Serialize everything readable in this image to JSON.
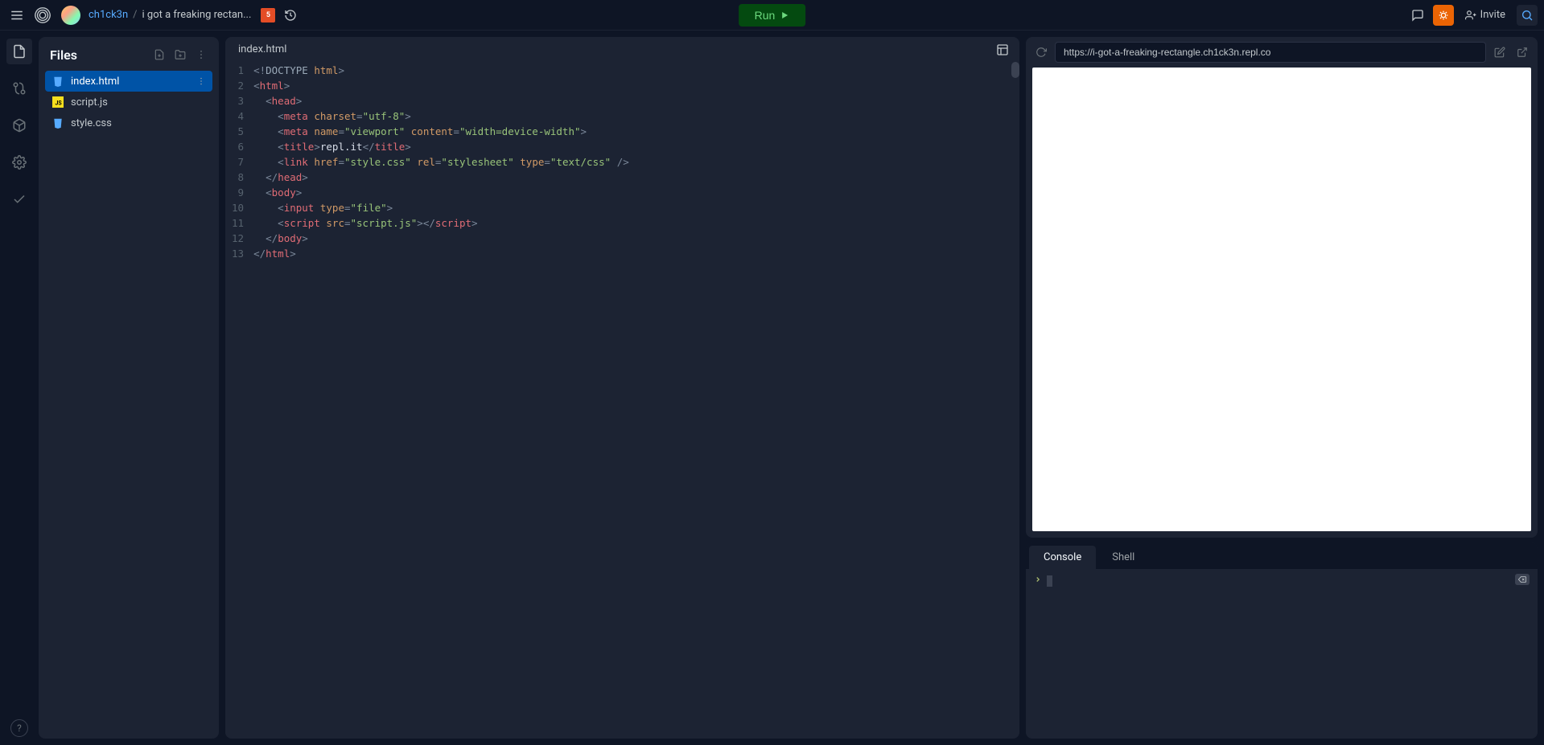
{
  "header": {
    "username": "ch1ck3n",
    "project": "i got a freaking rectan...",
    "run_label": "Run",
    "invite_label": "Invite",
    "lang_badge": "5"
  },
  "files": {
    "title": "Files",
    "items": [
      {
        "name": "index.html",
        "active": true,
        "icon": "html"
      },
      {
        "name": "script.js",
        "active": false,
        "icon": "js"
      },
      {
        "name": "style.css",
        "active": false,
        "icon": "css"
      }
    ]
  },
  "editor": {
    "tab": "index.html",
    "lines": 13,
    "code": [
      {
        "tokens": [
          {
            "c": "bracket",
            "t": "<!"
          },
          {
            "c": "doctype",
            "t": "DOCTYPE"
          },
          {
            "c": "text",
            "t": " "
          },
          {
            "c": "attr",
            "t": "html"
          },
          {
            "c": "bracket",
            "t": ">"
          }
        ]
      },
      {
        "tokens": [
          {
            "c": "bracket",
            "t": "<"
          },
          {
            "c": "tag",
            "t": "html"
          },
          {
            "c": "bracket",
            "t": ">"
          }
        ]
      },
      {
        "tokens": [
          {
            "c": "text",
            "t": "  "
          },
          {
            "c": "bracket",
            "t": "<"
          },
          {
            "c": "tag",
            "t": "head"
          },
          {
            "c": "bracket",
            "t": ">"
          }
        ]
      },
      {
        "tokens": [
          {
            "c": "text",
            "t": "    "
          },
          {
            "c": "bracket",
            "t": "<"
          },
          {
            "c": "tag",
            "t": "meta"
          },
          {
            "c": "text",
            "t": " "
          },
          {
            "c": "attr",
            "t": "charset"
          },
          {
            "c": "bracket",
            "t": "="
          },
          {
            "c": "str",
            "t": "\"utf-8\""
          },
          {
            "c": "bracket",
            "t": ">"
          }
        ]
      },
      {
        "tokens": [
          {
            "c": "text",
            "t": "    "
          },
          {
            "c": "bracket",
            "t": "<"
          },
          {
            "c": "tag",
            "t": "meta"
          },
          {
            "c": "text",
            "t": " "
          },
          {
            "c": "attr",
            "t": "name"
          },
          {
            "c": "bracket",
            "t": "="
          },
          {
            "c": "str",
            "t": "\"viewport\""
          },
          {
            "c": "text",
            "t": " "
          },
          {
            "c": "attr",
            "t": "content"
          },
          {
            "c": "bracket",
            "t": "="
          },
          {
            "c": "str",
            "t": "\"width=device-width\""
          },
          {
            "c": "bracket",
            "t": ">"
          }
        ]
      },
      {
        "tokens": [
          {
            "c": "text",
            "t": "    "
          },
          {
            "c": "bracket",
            "t": "<"
          },
          {
            "c": "tag",
            "t": "title"
          },
          {
            "c": "bracket",
            "t": ">"
          },
          {
            "c": "text",
            "t": "repl.it"
          },
          {
            "c": "bracket",
            "t": "</"
          },
          {
            "c": "tag",
            "t": "title"
          },
          {
            "c": "bracket",
            "t": ">"
          }
        ]
      },
      {
        "tokens": [
          {
            "c": "text",
            "t": "    "
          },
          {
            "c": "bracket",
            "t": "<"
          },
          {
            "c": "tag",
            "t": "link"
          },
          {
            "c": "text",
            "t": " "
          },
          {
            "c": "attr",
            "t": "href"
          },
          {
            "c": "bracket",
            "t": "="
          },
          {
            "c": "str",
            "t": "\"style.css\""
          },
          {
            "c": "text",
            "t": " "
          },
          {
            "c": "attr",
            "t": "rel"
          },
          {
            "c": "bracket",
            "t": "="
          },
          {
            "c": "str",
            "t": "\"stylesheet\""
          },
          {
            "c": "text",
            "t": " "
          },
          {
            "c": "attr",
            "t": "type"
          },
          {
            "c": "bracket",
            "t": "="
          },
          {
            "c": "str",
            "t": "\"text/css\""
          },
          {
            "c": "text",
            "t": " "
          },
          {
            "c": "bracket",
            "t": "/>"
          }
        ]
      },
      {
        "tokens": [
          {
            "c": "text",
            "t": "  "
          },
          {
            "c": "bracket",
            "t": "</"
          },
          {
            "c": "tag",
            "t": "head"
          },
          {
            "c": "bracket",
            "t": ">"
          }
        ]
      },
      {
        "tokens": [
          {
            "c": "text",
            "t": "  "
          },
          {
            "c": "bracket",
            "t": "<"
          },
          {
            "c": "tag",
            "t": "body"
          },
          {
            "c": "bracket",
            "t": ">"
          }
        ]
      },
      {
        "tokens": [
          {
            "c": "text",
            "t": "    "
          },
          {
            "c": "bracket",
            "t": "<"
          },
          {
            "c": "tag",
            "t": "input"
          },
          {
            "c": "text",
            "t": " "
          },
          {
            "c": "attr",
            "t": "type"
          },
          {
            "c": "bracket",
            "t": "="
          },
          {
            "c": "str",
            "t": "\"file\""
          },
          {
            "c": "bracket",
            "t": ">"
          }
        ]
      },
      {
        "tokens": [
          {
            "c": "text",
            "t": "    "
          },
          {
            "c": "bracket",
            "t": "<"
          },
          {
            "c": "tag",
            "t": "script"
          },
          {
            "c": "text",
            "t": " "
          },
          {
            "c": "attr",
            "t": "src"
          },
          {
            "c": "bracket",
            "t": "="
          },
          {
            "c": "str",
            "t": "\"script.js\""
          },
          {
            "c": "bracket",
            "t": "></"
          },
          {
            "c": "tag",
            "t": "script"
          },
          {
            "c": "bracket",
            "t": ">"
          }
        ]
      },
      {
        "tokens": [
          {
            "c": "text",
            "t": "  "
          },
          {
            "c": "bracket",
            "t": "</"
          },
          {
            "c": "tag",
            "t": "body"
          },
          {
            "c": "bracket",
            "t": ">"
          }
        ]
      },
      {
        "tokens": [
          {
            "c": "bracket",
            "t": "</"
          },
          {
            "c": "tag",
            "t": "html"
          },
          {
            "c": "bracket",
            "t": ">"
          }
        ]
      }
    ]
  },
  "preview": {
    "url": "https://i-got-a-freaking-rectangle.ch1ck3n.repl.co"
  },
  "console": {
    "tabs": {
      "console": "Console",
      "shell": "Shell"
    },
    "prompt": ">"
  }
}
